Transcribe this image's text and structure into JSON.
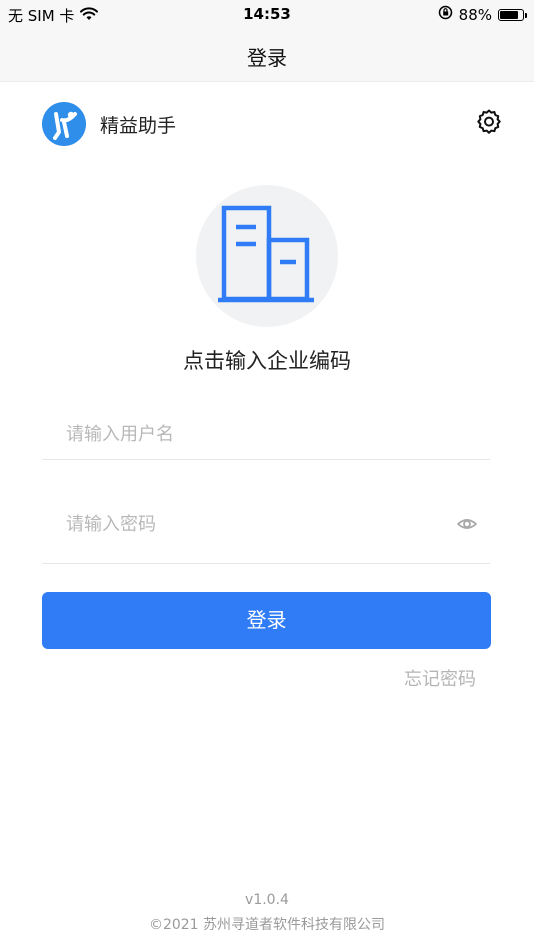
{
  "status_bar": {
    "carrier": "无 SIM 卡",
    "time": "14:53",
    "battery_percent": "88%",
    "battery_level": 0.88,
    "icons": [
      "wifi-icon",
      "orientation-lock-icon",
      "battery-icon"
    ]
  },
  "nav": {
    "title": "登录"
  },
  "brand": {
    "name": "精益助手",
    "logo_color": "#2f8ee9"
  },
  "company": {
    "prompt": "点击输入企业编码",
    "icon": "building-icon",
    "icon_color": "#2f7cf6"
  },
  "form": {
    "username_placeholder": "请输入用户名",
    "password_placeholder": "请输入密码",
    "login_label": "登录",
    "forgot_label": "忘记密码",
    "accent": "#2f7cf6"
  },
  "footer": {
    "version": "v1.0.4",
    "copyright": "©2021 苏州寻道者软件科技有限公司"
  }
}
